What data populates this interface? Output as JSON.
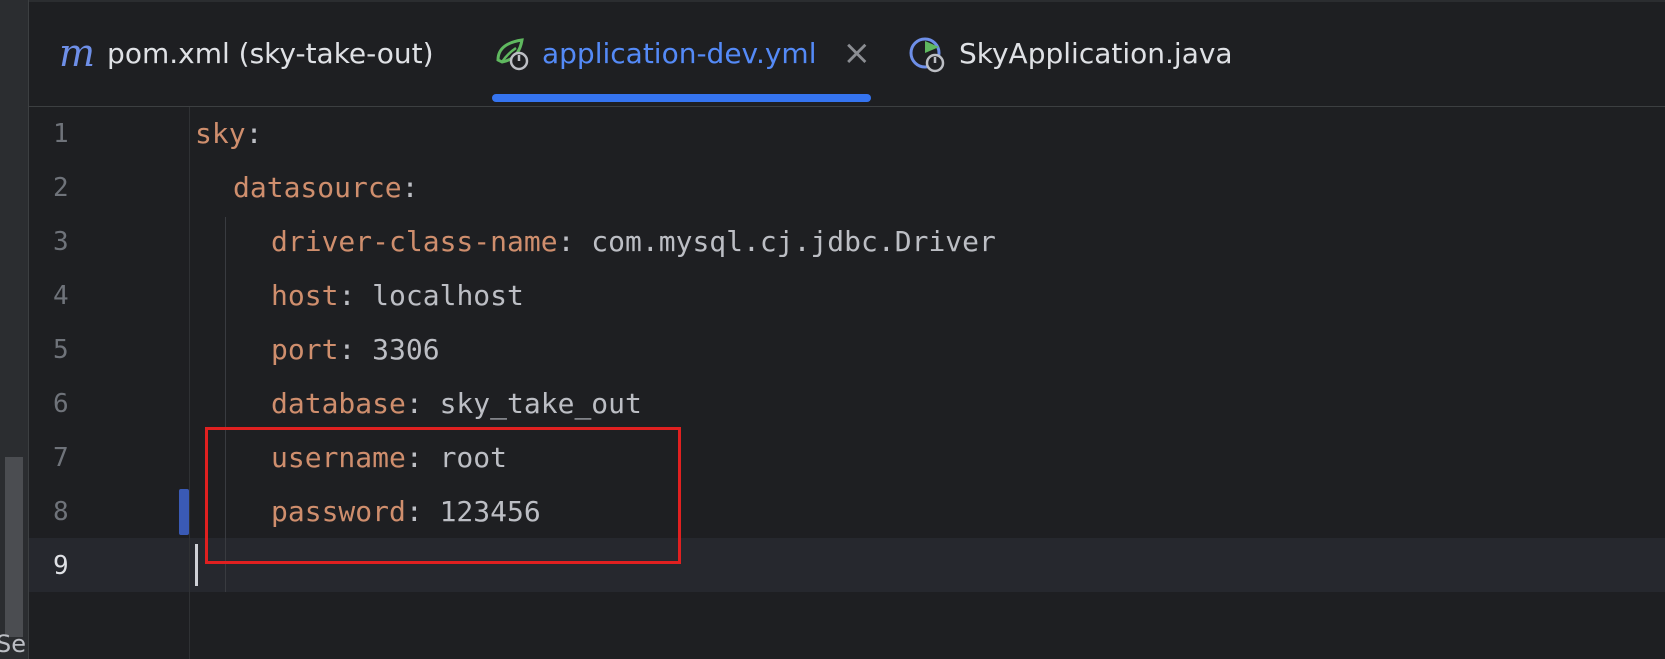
{
  "side": {
    "cut_label": "Se"
  },
  "tabs": [
    {
      "label": "pom.xml (sky-take-out)",
      "icon": "maven-m-icon",
      "icon_text": "m",
      "active": false
    },
    {
      "label": "application-dev.yml",
      "icon": "spring-config-icon",
      "active": true,
      "close": "×"
    },
    {
      "label": "SkyApplication.java",
      "icon": "spring-boot-run-icon",
      "active": false
    }
  ],
  "editor": {
    "line_numbers": [
      "1",
      "2",
      "3",
      "4",
      "5",
      "6",
      "7",
      "8",
      "9"
    ],
    "current_line": 9,
    "lines": [
      {
        "key": "sky",
        "sep": ":",
        "value": ""
      },
      {
        "key": "datasource",
        "sep": ":",
        "value": ""
      },
      {
        "key": "driver-class-name",
        "sep": ": ",
        "value": "com.mysql.cj.jdbc.Driver"
      },
      {
        "key": "host",
        "sep": ": ",
        "value": "localhost"
      },
      {
        "key": "port",
        "sep": ": ",
        "value": "3306"
      },
      {
        "key": "database",
        "sep": ": ",
        "value": "sky_take_out"
      },
      {
        "key": "username",
        "sep": ": ",
        "value": "root"
      },
      {
        "key": "password",
        "sep": ": ",
        "value": "123456"
      },
      {
        "key": "",
        "sep": "",
        "value": ""
      }
    ]
  },
  "colors": {
    "key": "#cf8e6d",
    "text": "#bcbec4",
    "accent": "#3574f0",
    "highlight": "#e02020"
  }
}
